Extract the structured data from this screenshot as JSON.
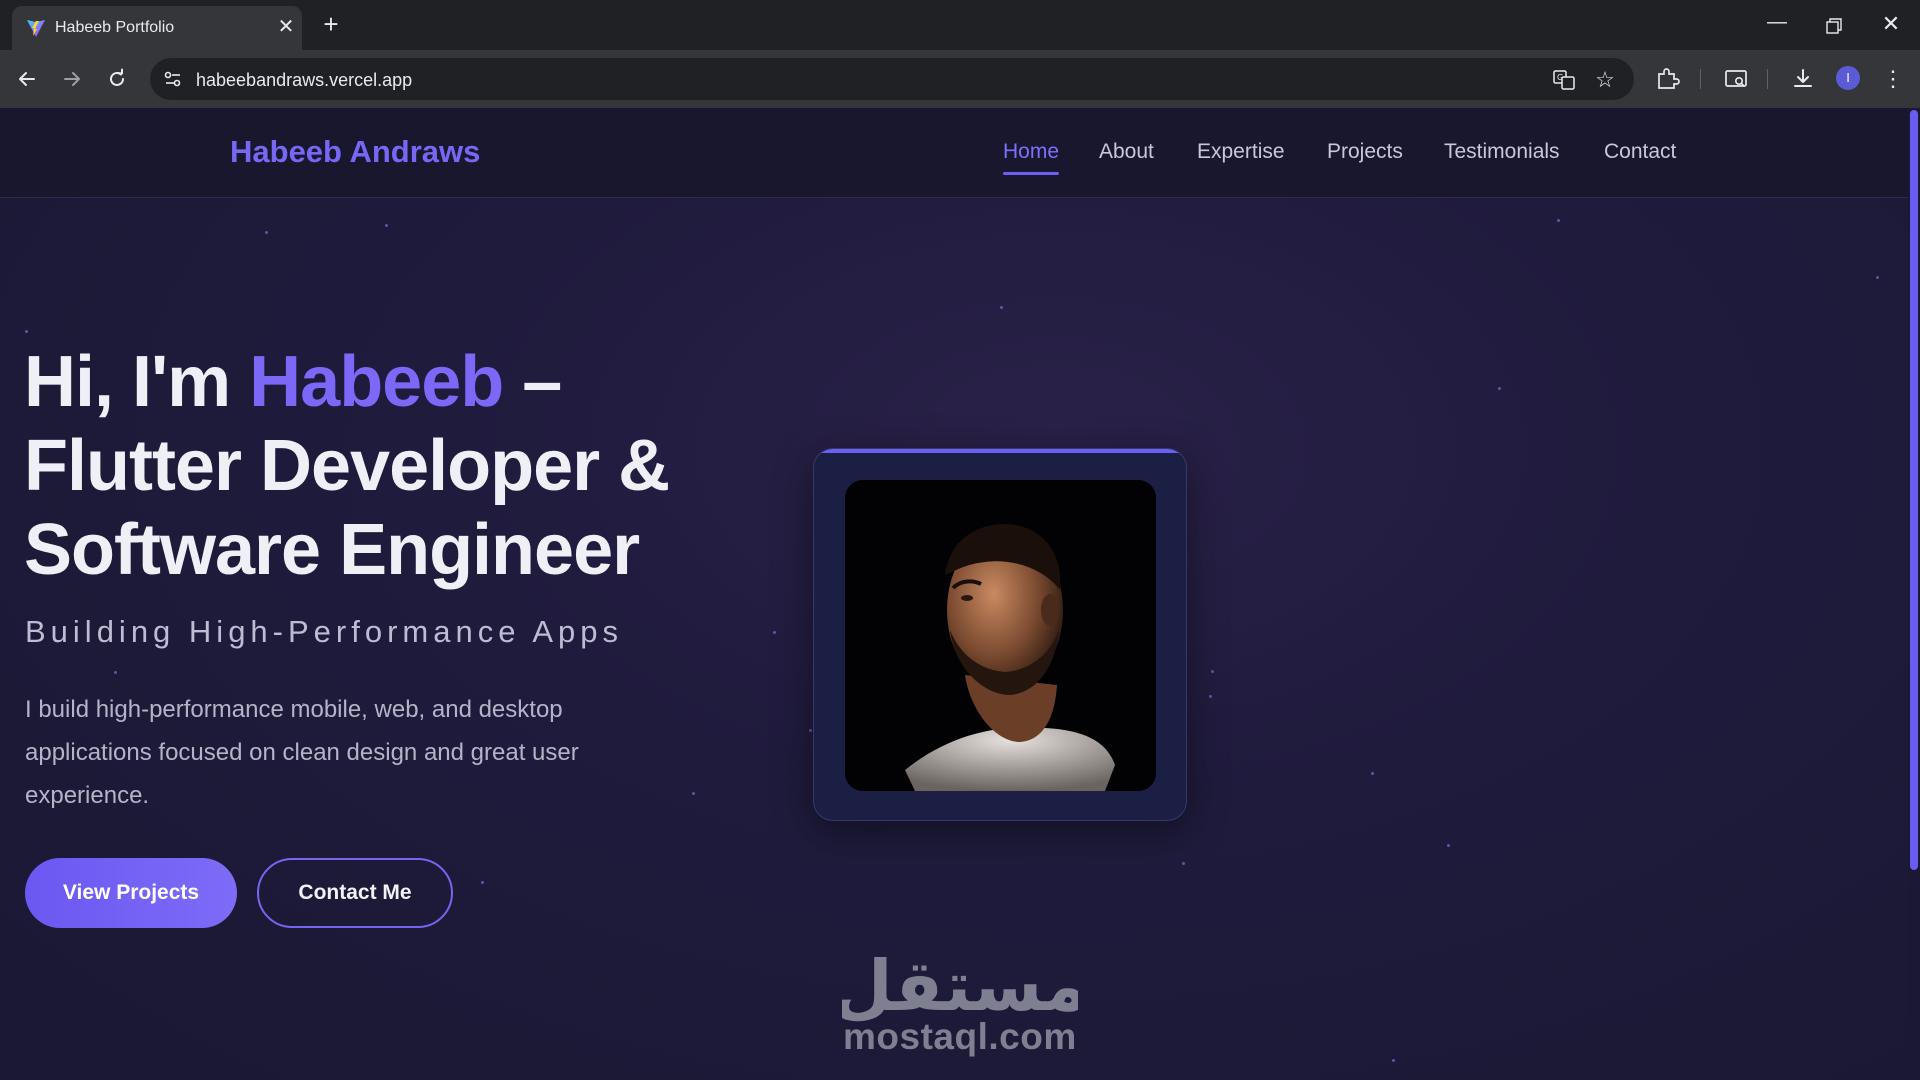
{
  "browser": {
    "tab_title": "Habeeb Portfolio",
    "tab_close": "✕",
    "new_tab": "+",
    "url": "habeebandraws.vercel.app",
    "avatar_initial": "I",
    "icons": {
      "favicon": "vite-logo-icon",
      "back": "arrow-left-icon",
      "forward": "arrow-right-icon",
      "reload": "reload-icon",
      "site_info": "tune-icon",
      "translate": "translate-icon",
      "bookmark": "star-icon",
      "extensions": "puzzle-icon",
      "cast": "cast-search-icon",
      "download": "download-icon",
      "menu": "kebab-menu-icon"
    }
  },
  "navbar": {
    "brand": "Habeeb Andraws",
    "links": [
      {
        "label": "Home",
        "active": true
      },
      {
        "label": "About"
      },
      {
        "label": "Expertise"
      },
      {
        "label": "Projects"
      },
      {
        "label": "Testimonials"
      },
      {
        "label": "Contact"
      }
    ]
  },
  "hero": {
    "title_prefix": "Hi, I'm ",
    "title_name": "Habeeb",
    "title_suffix": " – Flutter Developer & Software Engineer",
    "subtitle": "Building High-Performance Apps",
    "description": "I build high-performance mobile, web, and desktop applications focused on clean design and great user experience.",
    "primary_button": "View Projects",
    "secondary_button": "Contact Me"
  },
  "watermark": {
    "arabic": "مستقل",
    "latin": "mostaql.com"
  },
  "colors": {
    "accent": "#7b68f7",
    "page_bg": "#1f1b3d",
    "navbar_bg": "#18172e",
    "card_bg": "#1c1f44"
  }
}
